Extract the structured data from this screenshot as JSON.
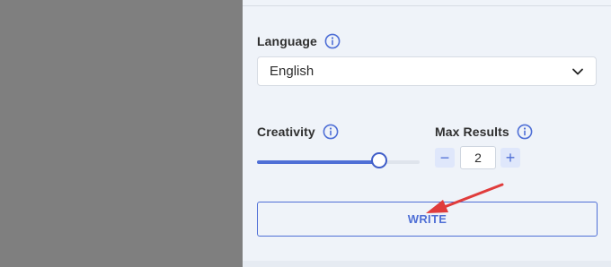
{
  "form": {
    "language_label": "Language",
    "language_value": "English",
    "creativity_label": "Creativity",
    "creativity_level": 0.75,
    "max_results_label": "Max Results",
    "max_results_value": "2",
    "decrement_symbol": "−",
    "increment_symbol": "+",
    "write_label": "WRITE"
  },
  "icons": {
    "info": "info-circle-icon",
    "chevron": "chevron-down-icon",
    "annotation": "red-arrow-annotation"
  },
  "colors": {
    "accent": "#4f6fd6",
    "panel_bg": "#eff3f9",
    "overlay": "#7f7f7f",
    "annotation_red": "#e03c3c"
  }
}
